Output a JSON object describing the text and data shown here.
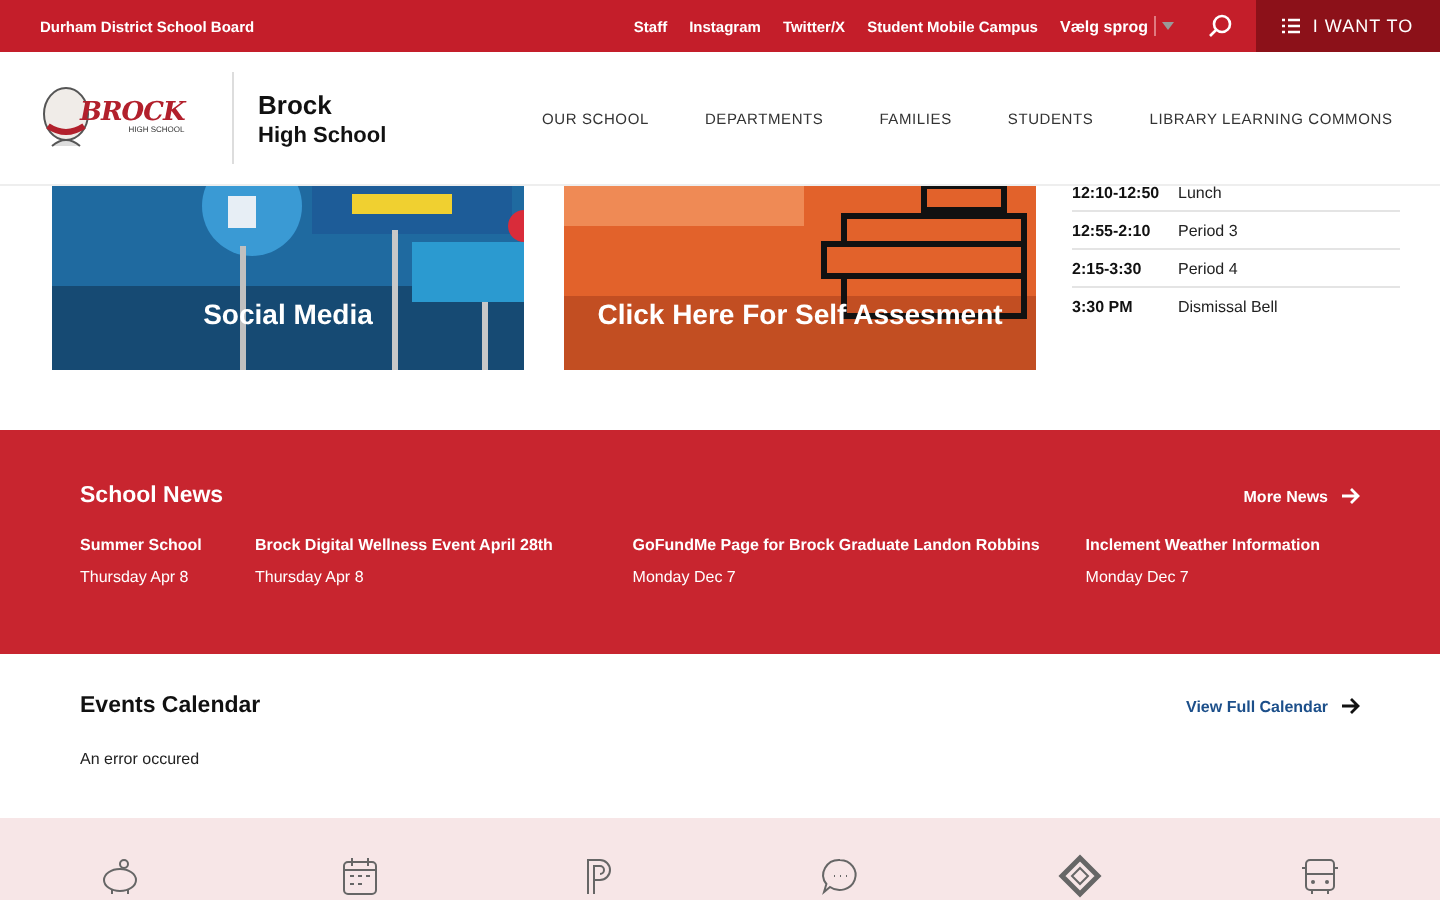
{
  "top_bar": {
    "board": "Durham District School Board",
    "links": [
      "Staff",
      "Instagram",
      "Twitter/X",
      "Student Mobile Campus"
    ],
    "language": "Vælg sprog",
    "i_want_to": "I WANT TO"
  },
  "header": {
    "logo": {
      "wordmark": "BROCK",
      "subtitle": "HIGH SCHOOL"
    },
    "school_name": "Brock",
    "school_type": "High School",
    "nav": [
      "OUR SCHOOL",
      "DEPARTMENTS",
      "FAMILIES",
      "STUDENTS",
      "LIBRARY LEARNING COMMONS"
    ]
  },
  "cards": [
    {
      "kind": "picture",
      "caption": "Social Media"
    },
    {
      "kind": "picture",
      "caption": "Click Here For Self Assesment"
    }
  ],
  "schedule": [
    {
      "time": "12:10-12:50",
      "label": "Lunch"
    },
    {
      "time": "12:55-2:10",
      "label": "Period 3"
    },
    {
      "time": "2:15-3:30",
      "label": "Period 4"
    },
    {
      "time": "3:30 PM",
      "label": "Dismissal Bell"
    }
  ],
  "news": {
    "title": "School News",
    "more": "More News",
    "items": [
      {
        "title": "Summer School",
        "date": "Thursday Apr 8"
      },
      {
        "title": "Brock Digital Wellness Event April 28th",
        "date": "Thursday Apr 8"
      },
      {
        "title": "GoFundMe Page for Brock Graduate Landon Robbins",
        "date": "Monday Dec 7"
      },
      {
        "title": "Inclement Weather Information",
        "date": "Monday Dec 7"
      }
    ]
  },
  "events": {
    "title": "Events Calendar",
    "link": "View Full Calendar",
    "message": "An error occured"
  },
  "quick_links": [
    {
      "kind": "piggy"
    },
    {
      "kind": "calendar"
    },
    {
      "kind": "p"
    },
    {
      "kind": "chat"
    },
    {
      "kind": "diamond"
    },
    {
      "kind": "bus"
    }
  ]
}
